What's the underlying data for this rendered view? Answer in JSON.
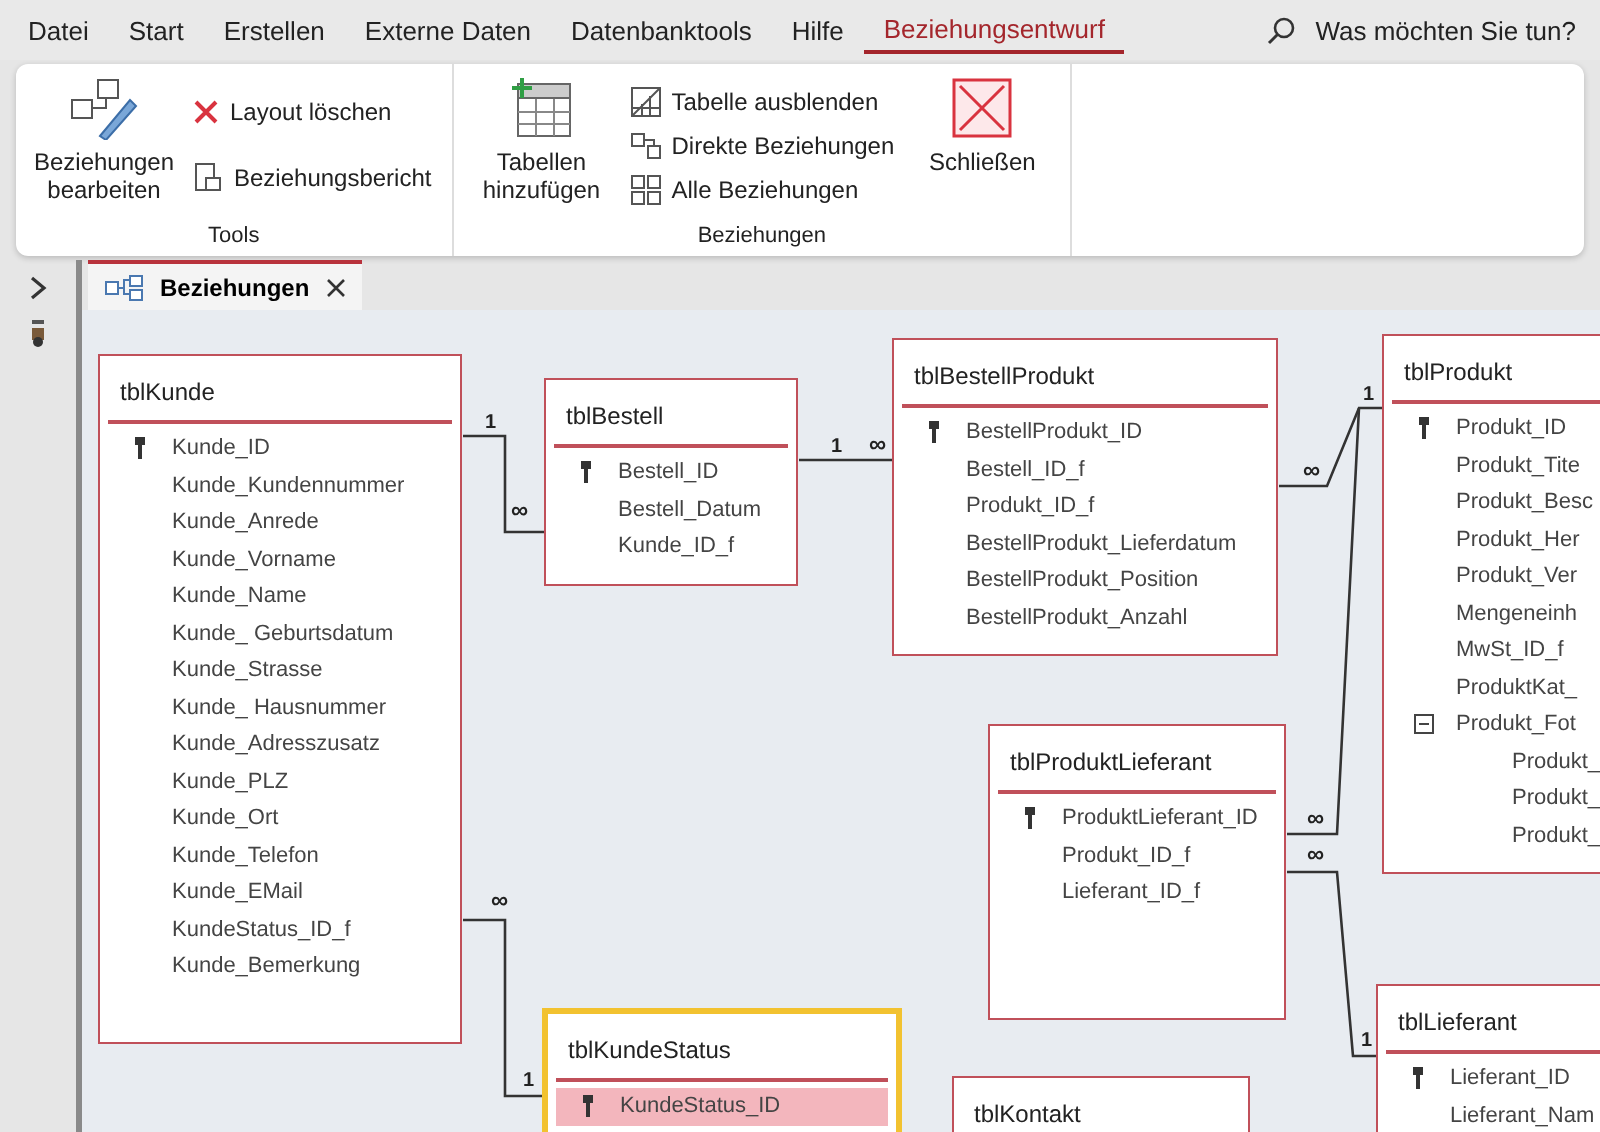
{
  "menu_tabs": [
    {
      "label": "Datei",
      "selected": false
    },
    {
      "label": "Start",
      "selected": false
    },
    {
      "label": "Erstellen",
      "selected": false
    },
    {
      "label": "Externe Daten",
      "selected": false
    },
    {
      "label": "Datenbanktools",
      "selected": false
    },
    {
      "label": "Hilfe",
      "selected": false
    },
    {
      "label": "Beziehungsentwurf",
      "selected": true
    }
  ],
  "tell_me": {
    "label": "Was möchten Sie tun?"
  },
  "ribbon_groups": [
    {
      "label": "Tools",
      "buttons": [
        {
          "label": "Beziehungen bearbeiten",
          "kind": "large"
        },
        {
          "label": "Layout löschen",
          "kind": "small"
        },
        {
          "label": "Beziehungsbericht",
          "kind": "small"
        }
      ]
    },
    {
      "label": "Beziehungen",
      "buttons": [
        {
          "label": "Tabellen hinzufügen",
          "kind": "large"
        },
        {
          "label": "Tabelle ausblenden",
          "kind": "small"
        },
        {
          "label": "Direkte Beziehungen",
          "kind": "small"
        },
        {
          "label": "Alle Beziehungen",
          "kind": "small"
        },
        {
          "label": "Schließen",
          "kind": "large"
        }
      ]
    }
  ],
  "document_tab": {
    "label": "Beziehungen",
    "selected": true
  },
  "tables": [
    {
      "title": "tblKunde",
      "selected": false,
      "fields": [
        {
          "name": "Kunde_ID",
          "key": true,
          "selected": false
        },
        {
          "name": "Kunde_Kundennummer",
          "key": false,
          "selected": false
        },
        {
          "name": "Kunde_Anrede",
          "key": false,
          "selected": false
        },
        {
          "name": "Kunde_Vorname",
          "key": false,
          "selected": false
        },
        {
          "name": "Kunde_Name",
          "key": false,
          "selected": false
        },
        {
          "name": "Kunde_ Geburtsdatum",
          "key": false,
          "selected": false
        },
        {
          "name": "Kunde_Strasse",
          "key": false,
          "selected": false
        },
        {
          "name": "Kunde_ Hausnummer",
          "key": false,
          "selected": false
        },
        {
          "name": "Kunde_Adresszusatz",
          "key": false,
          "selected": false
        },
        {
          "name": "Kunde_PLZ",
          "key": false,
          "selected": false
        },
        {
          "name": "Kunde_Ort",
          "key": false,
          "selected": false
        },
        {
          "name": "Kunde_Telefon",
          "key": false,
          "selected": false
        },
        {
          "name": "Kunde_EMail",
          "key": false,
          "selected": false
        },
        {
          "name": "KundeStatus_ID_f",
          "key": false,
          "selected": false
        },
        {
          "name": "Kunde_Bemerkung",
          "key": false,
          "selected": false
        }
      ]
    },
    {
      "title": "tblBestell",
      "selected": false,
      "fields": [
        {
          "name": "Bestell_ID",
          "key": true,
          "selected": false
        },
        {
          "name": "Bestell_Datum",
          "key": false,
          "selected": false
        },
        {
          "name": "Kunde_ID_f",
          "key": false,
          "selected": false
        }
      ]
    },
    {
      "title": "tblBestellProdukt",
      "selected": false,
      "fields": [
        {
          "name": "BestellProdukt_ID",
          "key": true,
          "selected": false
        },
        {
          "name": "Bestell_ID_f",
          "key": false,
          "selected": false
        },
        {
          "name": "Produkt_ID_f",
          "key": false,
          "selected": false
        },
        {
          "name": "BestellProdukt_Lieferdatum",
          "key": false,
          "selected": false
        },
        {
          "name": "BestellProdukt_Position",
          "key": false,
          "selected": false
        },
        {
          "name": "BestellProdukt_Anzahl",
          "key": false,
          "selected": false
        }
      ]
    },
    {
      "title": "tblProdukt",
      "selected": false,
      "fields": [
        {
          "name": "Produkt_ID",
          "key": true,
          "selected": false
        },
        {
          "name": "Produkt_Tite",
          "key": false,
          "selected": false
        },
        {
          "name": "Produkt_Besc",
          "key": false,
          "selected": false
        },
        {
          "name": "Produkt_Her",
          "key": false,
          "selected": false
        },
        {
          "name": "Produkt_Ver",
          "key": false,
          "selected": false
        },
        {
          "name": "Mengeneinh",
          "key": false,
          "selected": false
        },
        {
          "name": "MwSt_ID_f",
          "key": false,
          "selected": false
        },
        {
          "name": "ProduktKat_",
          "key": false,
          "selected": false
        },
        {
          "name": "Produkt_Fot",
          "key": false,
          "selected": false,
          "expanded": true,
          "children": [
            {
              "name": "Produkt_",
              "key": false,
              "selected": false
            },
            {
              "name": "Produkt_",
              "key": false,
              "selected": false
            },
            {
              "name": "Produkt_",
              "key": false,
              "selected": false
            }
          ]
        }
      ]
    },
    {
      "title": "tblProduktLieferant",
      "selected": false,
      "fields": [
        {
          "name": "ProduktLieferant_ID",
          "key": true,
          "selected": false
        },
        {
          "name": "Produkt_ID_f",
          "key": false,
          "selected": false
        },
        {
          "name": "Lieferant_ID_f",
          "key": false,
          "selected": false
        }
      ]
    },
    {
      "title": "tblKundeStatus",
      "selected": true,
      "fields": [
        {
          "name": "KundeStatus_ID",
          "key": true,
          "selected": true
        }
      ]
    },
    {
      "title": "tblKontakt",
      "selected": false
    },
    {
      "title": "tblLieferant",
      "selected": false,
      "fields": [
        {
          "name": "Lieferant_ID",
          "key": true,
          "selected": false
        },
        {
          "name": "Lieferant_Nam",
          "key": false,
          "selected": false
        }
      ]
    }
  ],
  "relationships": [
    {
      "one": "1",
      "many": "∞"
    },
    {
      "one": "1",
      "many": "∞"
    },
    {
      "one": "1",
      "many": "∞"
    },
    {
      "many": "∞"
    },
    {
      "one": "1",
      "many": "∞"
    },
    {
      "one": "1",
      "many": "∞"
    }
  ]
}
